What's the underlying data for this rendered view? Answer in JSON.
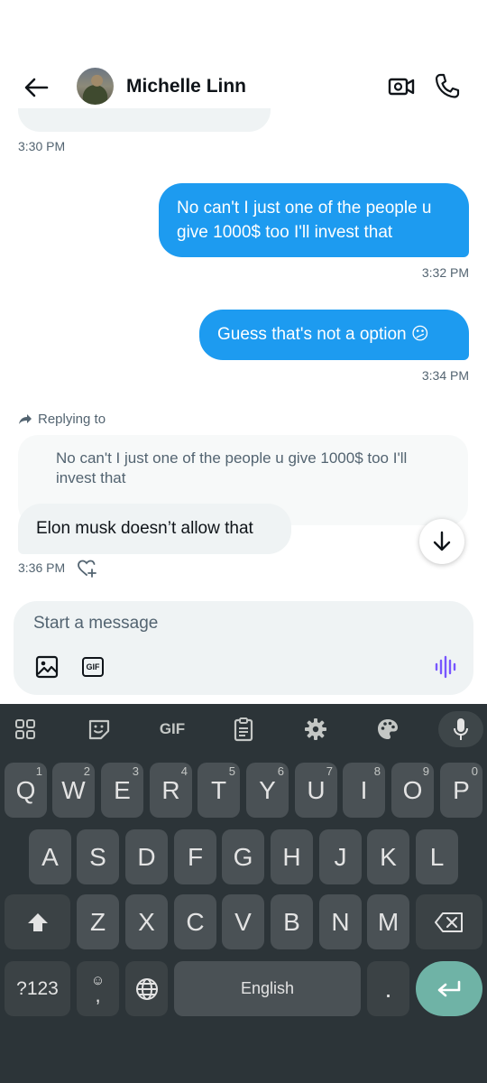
{
  "header": {
    "contact_name": "Michelle Linn"
  },
  "messages": [
    {
      "direction": "in",
      "text": "",
      "timestamp": "3:30 PM"
    },
    {
      "direction": "out",
      "text_line1": "No can't I just one of the people u",
      "text_line2": "give 1000$ too I'll invest that",
      "timestamp": "3:32 PM"
    },
    {
      "direction": "out",
      "text": "Guess that's not a option 😕",
      "timestamp": "3:34 PM"
    },
    {
      "direction": "in",
      "reply_label": "Replying to",
      "quoted_line1": "No can't I just one of the people u give 1000$ too I'll",
      "quoted_line2": "invest that",
      "text": "Elon musk doesn’t allow that",
      "timestamp": "3:36 PM"
    }
  ],
  "composer": {
    "placeholder": "Start a message",
    "gif_label": "GIF"
  },
  "keyboard": {
    "toolbar_gif": "GIF",
    "row1": [
      {
        "key": "Q",
        "hint": "1"
      },
      {
        "key": "W",
        "hint": "2"
      },
      {
        "key": "E",
        "hint": "3"
      },
      {
        "key": "R",
        "hint": "4"
      },
      {
        "key": "T",
        "hint": "5"
      },
      {
        "key": "Y",
        "hint": "6"
      },
      {
        "key": "U",
        "hint": "7"
      },
      {
        "key": "I",
        "hint": "8"
      },
      {
        "key": "O",
        "hint": "9"
      },
      {
        "key": "P",
        "hint": "0"
      }
    ],
    "row2": [
      "A",
      "S",
      "D",
      "F",
      "G",
      "H",
      "J",
      "K",
      "L"
    ],
    "row3": [
      "Z",
      "X",
      "C",
      "V",
      "B",
      "N",
      "M"
    ],
    "symbols_label": "?123",
    "comma_label": ",",
    "space_label": "English",
    "period_label": ".",
    "accent_color": "#6fb3a6"
  },
  "colors": {
    "bubble_out": "#1d9bf0",
    "bubble_in": "#eff3f4",
    "keyboard_bg": "#2c3438",
    "voice_icon": "#7856ff"
  }
}
